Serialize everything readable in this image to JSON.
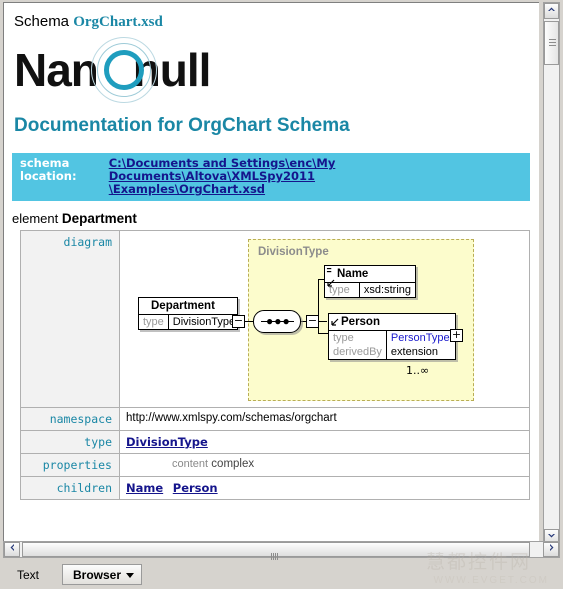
{
  "window": {
    "schema_prefix": "Schema",
    "schema_file": "OrgChart.xsd"
  },
  "logo": {
    "text_left": "Nan",
    "text_right": "null",
    "alt": "Nanonull"
  },
  "document": {
    "title": "Documentation for OrgChart Schema",
    "location_label_line1": "schema",
    "location_label_line2": "location:",
    "location_path_line1": "C:\\Documents and Settings\\enc\\My Documents\\Altova\\XMLSpy2011",
    "location_path_line2": "\\Examples\\OrgChart.xsd",
    "element_prefix": "element",
    "element_name": "Department"
  },
  "properties": {
    "rows": [
      {
        "label": "diagram",
        "value": ""
      },
      {
        "label": "namespace",
        "value": "http://www.xmlspy.com/schemas/orgchart"
      },
      {
        "label": "type",
        "value": "DivisionType"
      },
      {
        "label": "properties",
        "value": ""
      },
      {
        "label": "children",
        "value": ""
      }
    ],
    "properties_key": "content",
    "properties_value": "complex",
    "children": [
      "Name",
      "Person"
    ]
  },
  "diagram": {
    "group_label": "DivisionType",
    "dept": {
      "title": "Department",
      "key": "type",
      "value": "DivisionType",
      "toggle": "−"
    },
    "sequence_toggle": "−",
    "name": {
      "title": "Name",
      "key": "type",
      "value": "xsd:string"
    },
    "person": {
      "title": "Person",
      "key1": "type",
      "value1": "PersonType",
      "key2": "derivedBy",
      "value2": "extension",
      "toggle": "+",
      "cardinality": "1..∞"
    }
  },
  "tabs": {
    "text": "Text",
    "browser": "Browser"
  },
  "scrollbars": {
    "up": "▲",
    "down": "▼",
    "left": "❮",
    "right": "❯"
  },
  "watermark": {
    "cn": "慧都控件网",
    "url": "WWW.EVGET.COM"
  },
  "colors": {
    "accent_teal": "#1a87a5",
    "location_bar": "#52c5e2",
    "link_blue": "#15158c",
    "group_bg": "#fcfccc"
  }
}
